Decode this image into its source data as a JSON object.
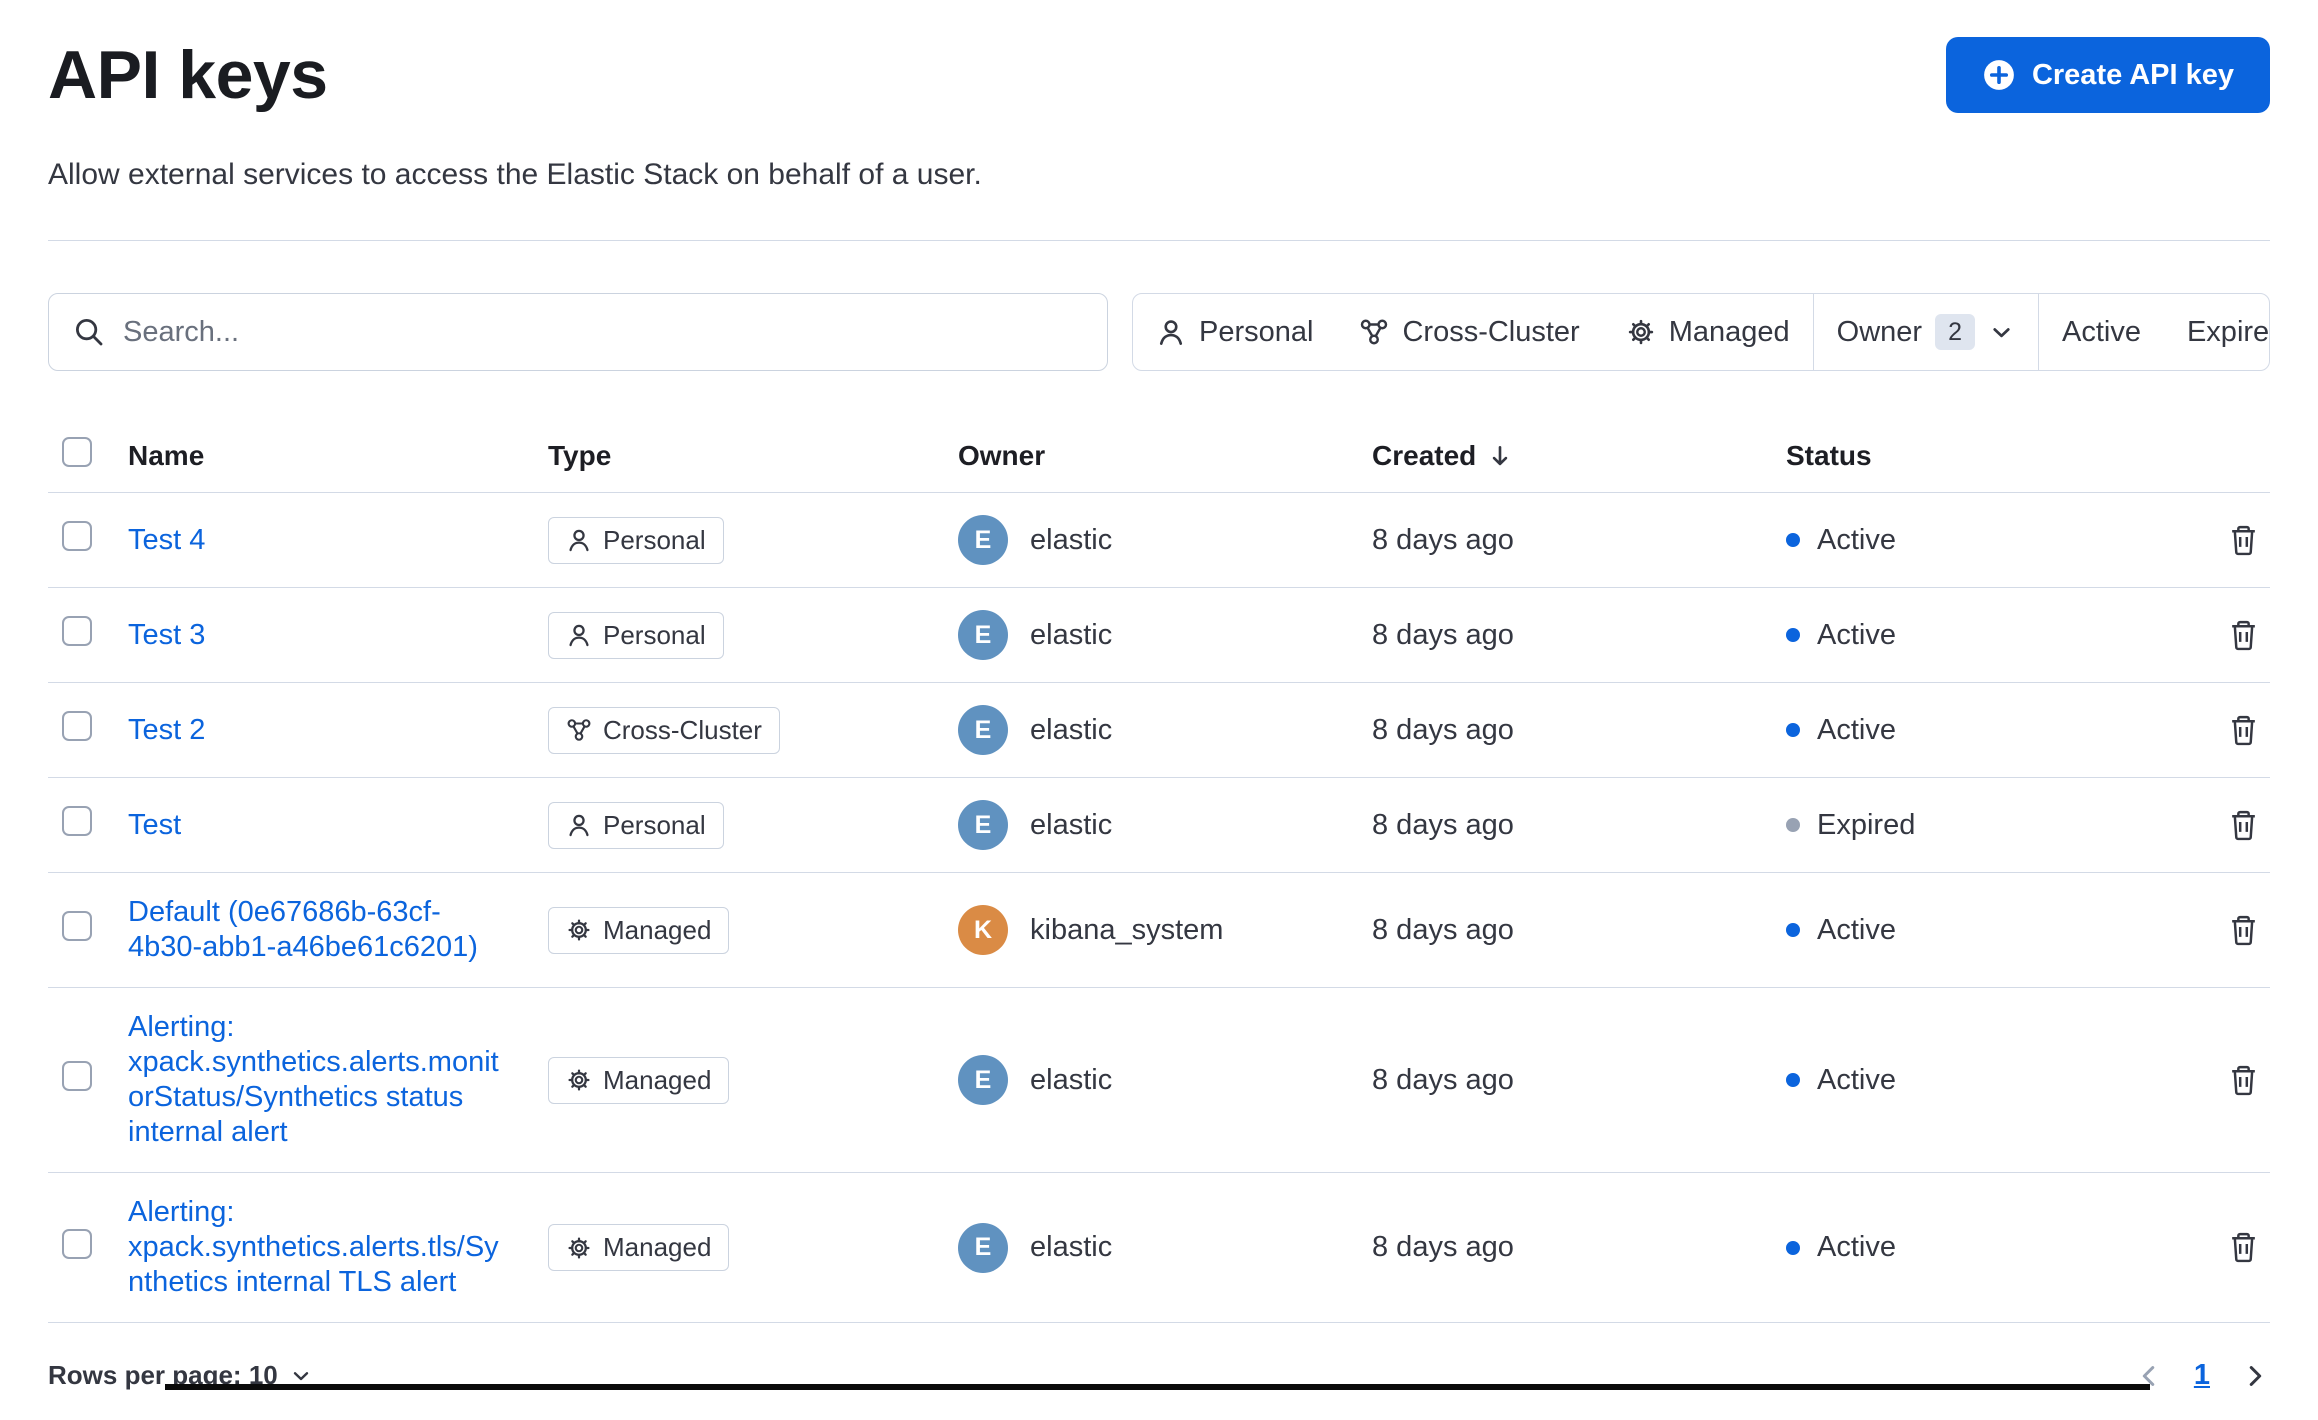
{
  "colors": {
    "primary": "#0B64DD",
    "link": "#0B64DD",
    "active_status": "#0B64DD",
    "expired_status": "#98A2B3"
  },
  "page": {
    "title": "API keys",
    "subtitle": "Allow external services to access the Elastic Stack on behalf of a user.",
    "create_button_label": "Create API key"
  },
  "toolbar": {
    "search_placeholder": "Search...",
    "filters": {
      "personal": "Personal",
      "cross_cluster": "Cross-Cluster",
      "managed": "Managed",
      "owner": "Owner",
      "owner_count": "2",
      "active": "Active",
      "expired": "Expired"
    }
  },
  "table": {
    "headers": {
      "name": "Name",
      "type": "Type",
      "owner": "Owner",
      "created": "Created",
      "status": "Status"
    },
    "sort": {
      "column": "Created",
      "direction": "descending"
    },
    "rows": [
      {
        "name": "Test 4",
        "type": "Personal",
        "type_icon": "user",
        "owner": "elastic",
        "avatar_letter": "E",
        "avatar_color": "#6092C0",
        "created": "8 days ago",
        "status": "Active"
      },
      {
        "name": "Test 3",
        "type": "Personal",
        "type_icon": "user",
        "owner": "elastic",
        "avatar_letter": "E",
        "avatar_color": "#6092C0",
        "created": "8 days ago",
        "status": "Active"
      },
      {
        "name": "Test 2",
        "type": "Cross-Cluster",
        "type_icon": "cluster",
        "owner": "elastic",
        "avatar_letter": "E",
        "avatar_color": "#6092C0",
        "created": "8 days ago",
        "status": "Active"
      },
      {
        "name": "Test",
        "type": "Personal",
        "type_icon": "user",
        "owner": "elastic",
        "avatar_letter": "E",
        "avatar_color": "#6092C0",
        "created": "8 days ago",
        "status": "Expired"
      },
      {
        "name": "Default (0e67686b-63cf-4b30-abb1-a46be61c6201)",
        "type": "Managed",
        "type_icon": "gear",
        "owner": "kibana_system",
        "avatar_letter": "K",
        "avatar_color": "#DA8B45",
        "created": "8 days ago",
        "status": "Active"
      },
      {
        "name": "Alerting: xpack.synthetics.alerts.monitorStatus/Synthetics status internal alert",
        "type": "Managed",
        "type_icon": "gear",
        "owner": "elastic",
        "avatar_letter": "E",
        "avatar_color": "#6092C0",
        "created": "8 days ago",
        "status": "Active"
      },
      {
        "name": "Alerting: xpack.synthetics.alerts.tls/Synthetics internal TLS alert",
        "type": "Managed",
        "type_icon": "gear",
        "owner": "elastic",
        "avatar_letter": "E",
        "avatar_color": "#6092C0",
        "created": "8 days ago",
        "status": "Active"
      }
    ]
  },
  "pagination": {
    "rows_per_page_label": "Rows per page: 10",
    "current_page": "1"
  }
}
